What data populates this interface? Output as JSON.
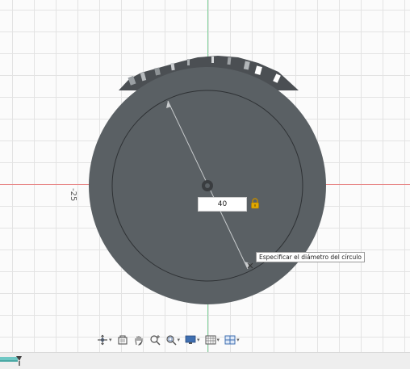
{
  "dimension": {
    "value": "40",
    "axis_label": "-25"
  },
  "tooltip": {
    "text": "Especificar el diámetro del círculo"
  },
  "icons": {
    "lock": "lock-icon",
    "orbit": "orbit-icon",
    "look_at": "look-at-icon",
    "pan": "pan-hand-icon",
    "zoom": "zoom-icon",
    "zoom_window": "zoom-window-icon",
    "display": "display-settings-icon",
    "grid": "grid-settings-icon",
    "viewports": "viewports-icon",
    "ground": "ground-plane-icon"
  },
  "colors": {
    "body": "#5a6064",
    "axis_x": "#e88a8a",
    "axis_y": "#7fd29a",
    "lock": "#e0a800"
  }
}
